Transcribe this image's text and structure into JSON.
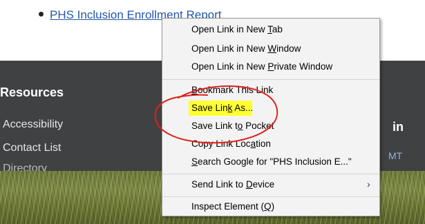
{
  "page": {
    "list_item_link": "PHS Inclusion Enrollment Report",
    "resources_title": "Resources",
    "resources_items": [
      "Accessibility",
      "Contact List",
      "Directory"
    ],
    "right_fragment_1": "in",
    "right_fragment_2": "MT"
  },
  "menu": {
    "items": {
      "open_new_tab": [
        "Open Link in New ",
        "T",
        "ab"
      ],
      "open_new_window": [
        "Open Link in New ",
        "W",
        "indow"
      ],
      "open_private": [
        "Open Link in New ",
        "P",
        "rivate Window"
      ],
      "bookmark": [
        "",
        "B",
        "ookmark This Link"
      ],
      "save_link_as": [
        "Save Lin",
        "k",
        " As..."
      ],
      "save_to_pocket": [
        "Save Link t",
        "o",
        " Pocket"
      ],
      "copy_location": [
        "Copy Link Loc",
        "a",
        "tion"
      ],
      "search_google": [
        "",
        "S",
        "earch Google for \"PHS Inclusion E...\""
      ],
      "send_to_device": [
        "Send Link to ",
        "D",
        "evice"
      ],
      "inspect": [
        "Inspect Element (",
        "Q",
        ")"
      ]
    },
    "submenu_arrow": "›"
  },
  "colors": {
    "highlight": "#ffff33",
    "annotation_red": "#e0201a",
    "dark_band": "#404142"
  }
}
